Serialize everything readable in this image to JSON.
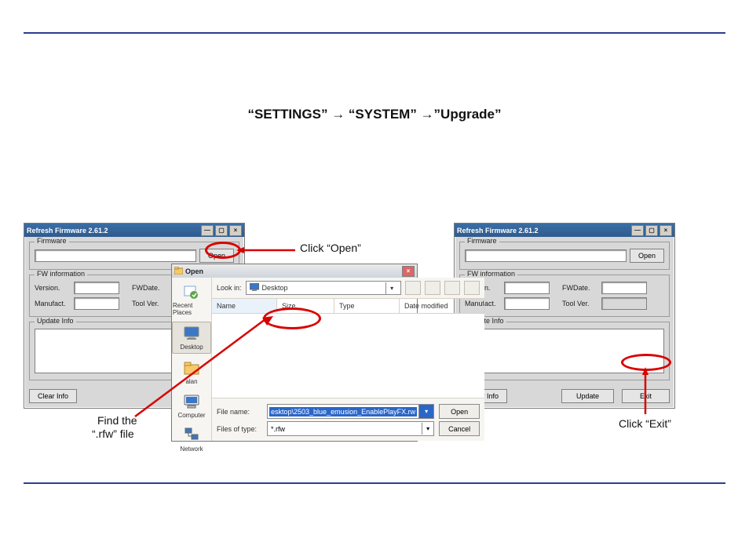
{
  "heading": "“SETTINGS” → “SYSTEM” →”Upgrade”",
  "annotations": {
    "click_open": "Click “Open”",
    "find_file_line1": "Find the",
    "find_file_line2": "“.rfw” file",
    "click_exit": "Click “Exit”"
  },
  "refresh_window": {
    "title": "Refresh Firmware 2.61.2",
    "panels": {
      "firmware": "Firmware",
      "fw_info": "FW information",
      "update_info": "Update Info"
    },
    "labels": {
      "version": "Version.",
      "manufact": "Manufact.",
      "fwdate": "FWDate.",
      "tool_ver": "Tool Ver."
    },
    "buttons": {
      "open": "Open",
      "clear_info": "Clear Info",
      "update": "Update",
      "exit": "Exit"
    }
  },
  "open_dialog": {
    "title": "Open",
    "look_in_label": "Look in:",
    "look_in_value": "Desktop",
    "columns": {
      "name": "Name",
      "size": "Size",
      "type": "Type",
      "date": "Date modified"
    },
    "places": [
      "Recent Places",
      "Desktop",
      "alan",
      "Computer",
      "Network"
    ],
    "filename_label": "File name:",
    "filename_value": "esktop\\2503_blue_emusion_EnablePlayFX.rw",
    "filetype_label": "Files of type:",
    "filetype_value": "*.rfw",
    "buttons": {
      "open": "Open",
      "cancel": "Cancel"
    }
  }
}
